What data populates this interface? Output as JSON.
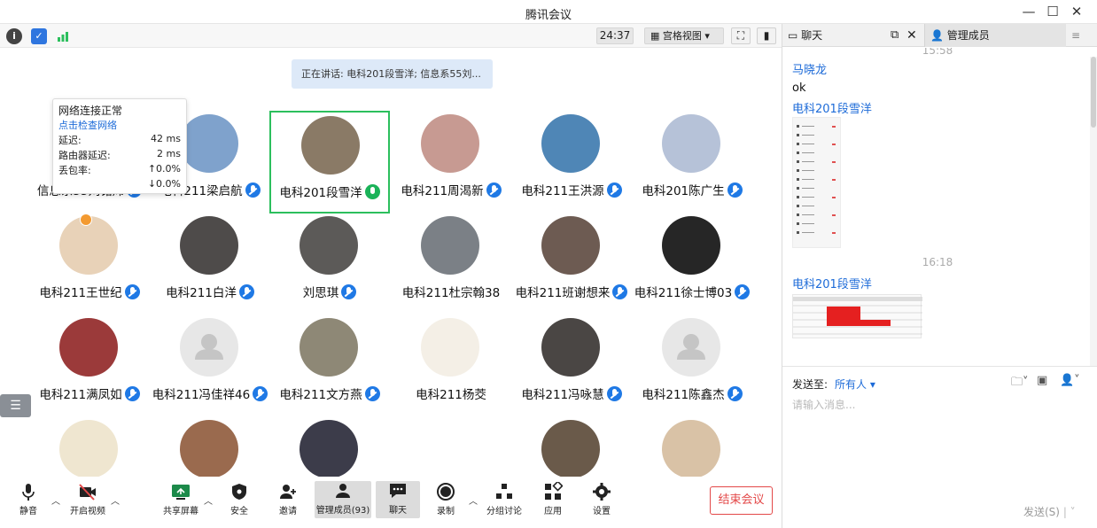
{
  "window": {
    "title": "腾讯会议",
    "minimize": "—",
    "maximize": "☐",
    "close": "✕"
  },
  "toolbar": {
    "info_icon": "i",
    "shield_icon": "✓",
    "timer": "24:37",
    "grid_view_label": "宫格视图",
    "grid_view_caret": "▾",
    "fullscreen_icon": "⛶",
    "sidebar_icon": "▮"
  },
  "network_popup": {
    "status": "网络连接正常",
    "check_link": "点击检查网络",
    "rows": [
      {
        "label": "延迟:",
        "value": "42 ms"
      },
      {
        "label": "路由器延迟:",
        "value": "2 ms"
      },
      {
        "label": "丢包率:",
        "value": "↑0.0%"
      },
      {
        "label": "",
        "value": "↓0.0%"
      }
    ]
  },
  "speaking_banner": "正在讲话: 电科201段雪洋; 信息系55刘...",
  "participants": [
    {
      "name": "信息系55刘铭炜",
      "avatar_color": "#2a2a2a",
      "mic": "muted"
    },
    {
      "name": "电科211梁启航",
      "avatar_color": "#7fa2cc",
      "mic": "muted"
    },
    {
      "name": "电科201段雪洋",
      "avatar_color": "#8a7a66",
      "mic": "on"
    },
    {
      "name": "电科211周渴新",
      "avatar_color": "#c79a92",
      "mic": "muted"
    },
    {
      "name": "电科211王洪源",
      "avatar_color": "#4f86b6",
      "mic": "muted"
    },
    {
      "name": "电科201陈广生",
      "avatar_color": "#b6c2d8",
      "mic": "muted"
    },
    {
      "name": "电科211王世纪",
      "avatar_color": "#e8d2b8",
      "mic": "muted"
    },
    {
      "name": "电科211白洋",
      "avatar_color": "#4e4b4a",
      "mic": "muted"
    },
    {
      "name": "刘思琪",
      "avatar_color": "#5c5a58",
      "mic": "muted"
    },
    {
      "name": "电科211杜宗翰38",
      "avatar_color": "#7b8086",
      "mic": "none"
    },
    {
      "name": "电科211班谢想来",
      "avatar_color": "#6d5b52",
      "mic": "muted"
    },
    {
      "name": "电科211徐士博03",
      "avatar_color": "#262626",
      "mic": "muted"
    },
    {
      "name": "电科211满凤如",
      "avatar_color": "#9b3a3a",
      "mic": "muted"
    },
    {
      "name": "电科211冯佳祥46",
      "avatar_color": "#e7e7e7",
      "mic": "muted"
    },
    {
      "name": "电科211文方燕",
      "avatar_color": "#8e8876",
      "mic": "muted"
    },
    {
      "name": "电科211杨茭",
      "avatar_color": "#f4efe6",
      "mic": "none"
    },
    {
      "name": "电科211冯咏慧",
      "avatar_color": "#4a4644",
      "mic": "muted"
    },
    {
      "name": "电科211陈鑫杰",
      "avatar_color": "#e7e7e7",
      "mic": "muted"
    },
    {
      "name": "",
      "avatar_color": "#efe6d0",
      "mic": "none"
    },
    {
      "name": "",
      "avatar_color": "#9a6a4e",
      "mic": "none"
    },
    {
      "name": "",
      "avatar_color": "#3c3c4a",
      "mic": "none"
    },
    {
      "name": "",
      "avatar_color": "#ffffff",
      "mic": "none"
    },
    {
      "name": "",
      "avatar_color": "#6a5a4a",
      "mic": "none"
    },
    {
      "name": "",
      "avatar_color": "#d9c2a6",
      "mic": "none"
    }
  ],
  "bottom_bar": {
    "mute": "静音",
    "video": "开启视频",
    "share": "共享屏幕",
    "security": "安全",
    "invite": "邀请",
    "members": "管理成员(93)",
    "chat": "聊天",
    "record": "录制",
    "breakout": "分组讨论",
    "apps": "应用",
    "settings": "设置",
    "end": "结束会议"
  },
  "chat": {
    "tab_chat": "聊天",
    "tab_members": "管理成员",
    "timestamp_top": "15:58",
    "messages": [
      {
        "sender": "马晓龙",
        "text": "ok"
      },
      {
        "sender": "电科201段雪洋",
        "text": ""
      }
    ],
    "timestamp_mid": "16:18",
    "sender_last": "电科201段雪洋",
    "send_to_label": "发送至:",
    "send_to_value": "所有人",
    "input_placeholder": "请输入消息...",
    "send_button": "发送(S)"
  },
  "colors": {
    "accent": "#1d6bd8",
    "mic_blue": "#1f79e5",
    "active_green": "#2cbf5d",
    "end_red": "#e34848"
  }
}
